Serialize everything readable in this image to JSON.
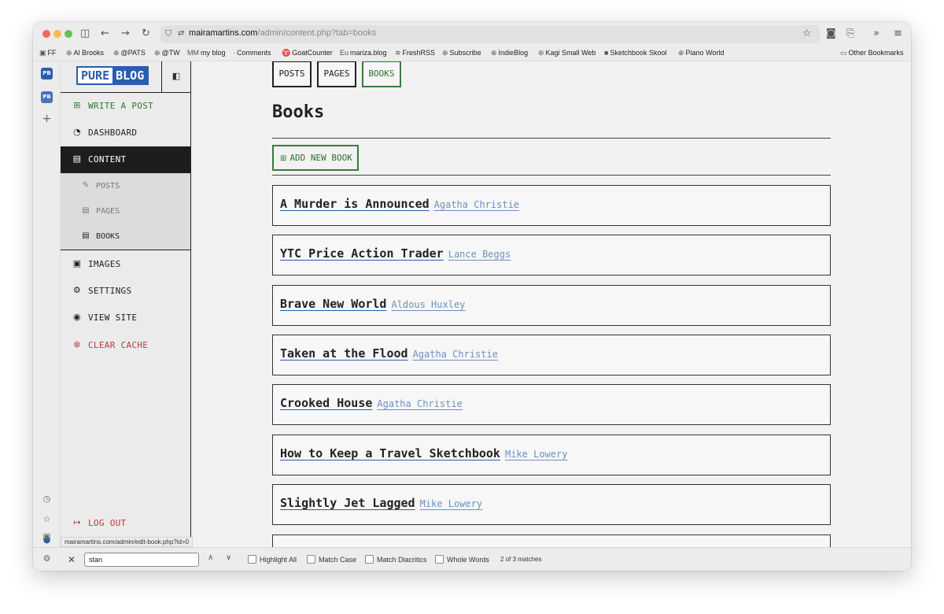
{
  "browser": {
    "url_host": "mairamartins.com",
    "url_path": "/admin/content.php?tab=books",
    "bookmarks": [
      {
        "label": "FF",
        "icon": "ff-icon"
      },
      {
        "label": "Al Brooks",
        "icon": "globe-icon"
      },
      {
        "label": "@PATS",
        "icon": "globe-icon"
      },
      {
        "label": "@TW",
        "icon": "globe-icon"
      },
      {
        "label": "my blog",
        "icon": "mm-icon"
      },
      {
        "label": "Comments",
        "icon": "comment-icon"
      },
      {
        "label": "GoatCounter",
        "icon": "goat-icon"
      },
      {
        "label": "mariza.blog",
        "icon": "eu-icon"
      },
      {
        "label": "FreshRSS",
        "icon": "rss-icon"
      },
      {
        "label": "Subscribe",
        "icon": "globe-icon"
      },
      {
        "label": "IndieBlog",
        "icon": "globe-icon"
      },
      {
        "label": "Kagi Small Web",
        "icon": "kagi-icon"
      },
      {
        "label": "Sketchbook Skool",
        "icon": "sketch-icon"
      },
      {
        "label": "Piano World",
        "icon": "globe-icon"
      }
    ],
    "other_bookmarks": "Other Bookmarks",
    "status_url": "mairamartins.com/admin/edit-book.php?id=0"
  },
  "find_bar": {
    "query": "stan",
    "options": [
      "Highlight All",
      "Match Case",
      "Match Diacritics",
      "Whole Words"
    ],
    "result": "2 of 3 matches"
  },
  "sidebar": {
    "logo_left": "PURE",
    "logo_right": "BLOG",
    "items": [
      {
        "label": "WRITE A POST",
        "icon": "new-file-icon"
      },
      {
        "label": "DASHBOARD",
        "icon": "gauge-icon"
      },
      {
        "label": "CONTENT",
        "icon": "document-icon"
      },
      {
        "label": "IMAGES",
        "icon": "image-icon"
      },
      {
        "label": "SETTINGS",
        "icon": "gear-icon"
      },
      {
        "label": "VIEW SITE",
        "icon": "eye-icon"
      },
      {
        "label": "CLEAR CACHE",
        "icon": "x-circle-icon"
      }
    ],
    "subitems": [
      {
        "label": "POSTS",
        "icon": "edit-icon"
      },
      {
        "label": "PAGES",
        "icon": "page-icon"
      },
      {
        "label": "BOOKS",
        "icon": "book-file-icon"
      }
    ],
    "logout": "LOG OUT"
  },
  "main": {
    "tabs": [
      "POSTS",
      "PAGES",
      "BOOKS"
    ],
    "active_tab": "BOOKS",
    "title": "Books",
    "add_button": "ADD NEW BOOK",
    "books": [
      {
        "title": "A Murder is Announced",
        "author": "Agatha Christie"
      },
      {
        "title": "YTC Price Action Trader",
        "author": "Lance Beggs"
      },
      {
        "title": "Brave New World",
        "author": "Aldous Huxley"
      },
      {
        "title": "Taken at the Flood",
        "author": "Agatha Christie"
      },
      {
        "title": "Crooked House",
        "author": "Agatha Christie"
      },
      {
        "title": "How to Keep a Travel Sketchbook",
        "author": "Mike Lowery"
      },
      {
        "title": "Slightly Jet Lagged",
        "author": "Mike Lowery"
      }
    ]
  },
  "colors": {
    "brand_blue": "#2a5db0",
    "green": "#2f6f2f",
    "red": "#b83a3a",
    "active_bg": "#1d1d1d"
  }
}
